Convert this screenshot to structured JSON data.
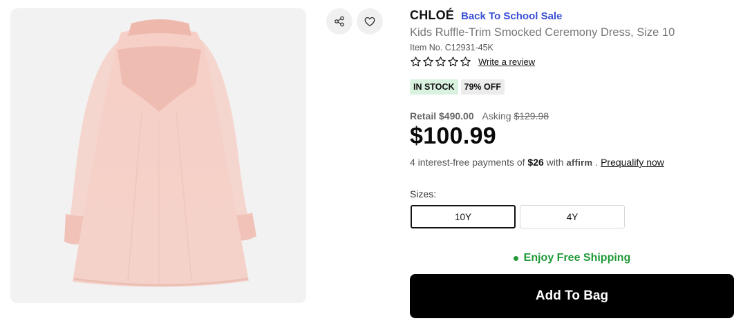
{
  "product": {
    "brand": "CHLOÉ",
    "sale_link": "Back To School Sale",
    "title": "Kids Ruffle-Trim Smocked Ceremony Dress, Size 10",
    "item_no": "Item No. C12931-45K",
    "rating_stars": 0,
    "rating_max": 5,
    "review_link": "Write a review",
    "badges": {
      "stock": "IN STOCK",
      "discount": "79% OFF"
    },
    "retail": "Retail $490.00",
    "asking_label": "Asking",
    "asking_value": "$129.98",
    "price": "$100.99",
    "affirm": {
      "prefix": "4 interest-free payments of",
      "amount": "$26",
      "with": "with",
      "logo": "affirm",
      "dot": ".",
      "prequalify": "Prequalify now"
    },
    "sizes_label": "Sizes:",
    "sizes": [
      {
        "label": "10Y",
        "selected": true
      },
      {
        "label": "4Y",
        "selected": false
      }
    ],
    "shipping": "Enjoy Free Shipping",
    "add_to_bag": "Add To Bag"
  },
  "actions": {
    "share_icon": "share-icon",
    "wishlist_icon": "heart-icon"
  },
  "colors": {
    "sale_link": "#3a4fd4",
    "shipping": "#1f9a37",
    "in_stock_bg": "#d9f2df",
    "cta_bg": "#000000"
  }
}
